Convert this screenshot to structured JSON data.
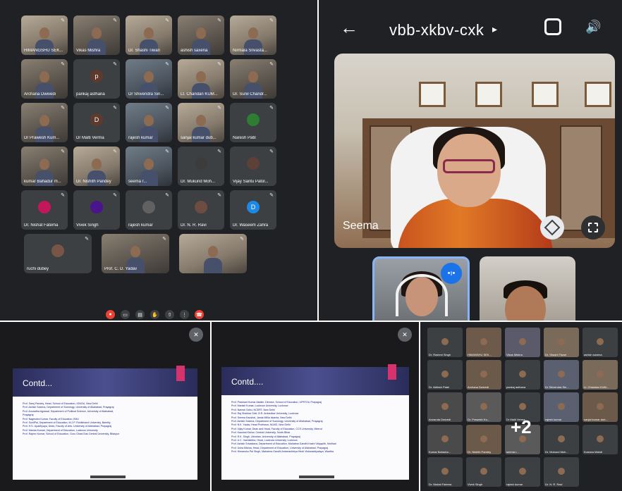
{
  "panel_grid": {
    "tiles": [
      {
        "name": "HIMANGSHU SEK...",
        "type": "video2"
      },
      {
        "name": "Vikas Mishra",
        "type": "video"
      },
      {
        "name": "Dr. Shashi Tiwari",
        "type": "video2"
      },
      {
        "name": "ashish saxena",
        "type": "video"
      },
      {
        "name": "Nirmala Srivasta...",
        "type": "video2"
      },
      {
        "name": "Archana Dwivedi",
        "type": "video"
      },
      {
        "name": "pankaj asthana",
        "type": "avatar",
        "initial": "p",
        "color": "#5e3a2c"
      },
      {
        "name": "Dr Shivendra Sin...",
        "type": "video3"
      },
      {
        "name": "Lt. Chandan KUM...",
        "type": "video2"
      },
      {
        "name": "Dr. Sunil Chandr...",
        "type": "video"
      },
      {
        "name": "Dr Prawesh Kum...",
        "type": "video"
      },
      {
        "name": "Dr Malti Verma",
        "type": "avatar",
        "initial": "D",
        "color": "#5e3a2c"
      },
      {
        "name": "rajesh kumar",
        "type": "video3"
      },
      {
        "name": "sanjai kumar dub...",
        "type": "video2"
      },
      {
        "name": "Naresh Patil",
        "type": "avatar",
        "initial": "",
        "color": "#2e7d32"
      },
      {
        "name": "kumar Bahadur m...",
        "type": "video"
      },
      {
        "name": "Dr. Nishith Pandey",
        "type": "video2"
      },
      {
        "name": "seema r...",
        "type": "video3"
      },
      {
        "name": "Dr. Mukund Moh...",
        "type": "avatar",
        "initial": "",
        "color": "#3c3c3c"
      },
      {
        "name": "Vijay Santu Patol...",
        "type": "avatar",
        "initial": "",
        "color": "#5d4037"
      },
      {
        "name": "Dr. Nishat Fatema",
        "type": "avatar",
        "initial": "",
        "color": "#c2185b"
      },
      {
        "name": "Vivek Singh",
        "type": "avatar",
        "initial": "",
        "color": "#4a148c"
      },
      {
        "name": "rajesh kumar",
        "type": "avatar",
        "initial": "",
        "color": "#616161"
      },
      {
        "name": "Dr. N. R. Ravi",
        "type": "avatar",
        "initial": "",
        "color": "#6d4c41"
      },
      {
        "name": "Dr. Waseem Zahra",
        "type": "avatar",
        "initial": "D",
        "color": "#1e88e5"
      },
      {
        "name": "ruchi dubey",
        "type": "avatar",
        "initial": "",
        "color": "#795548"
      },
      {
        "name": "Prof. C. D. Yadav",
        "type": "video"
      },
      {
        "name": "",
        "type": "video2"
      }
    ]
  },
  "panel_meet": {
    "meeting_code": "vbb-xkbv-cxk",
    "back_glyph": "←",
    "caret_glyph": "▸",
    "speaker_glyph": "🔊",
    "speaker_name": "Seema",
    "talking_glyph": "•ı•"
  },
  "slides": [
    {
      "title": "Contd...",
      "lines": [
        "Prof. Saroj Pandey, Head, School of Education, IGNOU, New Delhi",
        "Prof. Ashish Saxena, Department of Sociology, University of Allahabad, Prayagraj",
        "Prof. Anuradha Agrawal, Department of Political Science, University of Allahabad,",
        "Prayagraj",
        "Prof. Nagendra Kumar, Faculty of Education, BHU",
        "Prof. SunilPal, Department of Education, M.J.P. Rohilkhand University, Bareilly",
        "Prof. H.S. Upadhyaya, Dean, Faculty of Arts, University of Allahabad, Prayagraj",
        "Prof. Mamta Kumari, Department of Education, Lucknow University",
        "Prof. Rajeev Kumar, School of Education, Guru Ghasi Das Central University, Bilaspur"
      ]
    },
    {
      "title": "Contd....",
      "lines": [
        "Prof. Prashant Kumar Astalin, Director, School of Education, UPRTOU Prayagraj",
        "Prof. Manish Kumar, Lucknow University, Lucknow",
        "Prof. Naresh Sahu, NCERT, New Delhi",
        "Prof. Raj Shekhar Dixit, B.R. Ambedkar University, Lucknow",
        "Prof. Seema Kaushal, Jamia Millia Islamia, New Delhi",
        "Prof. Ashish Saxena, Department of Sociology, University of Allahabad, Prayagraj",
        "Prof. N.K. Yadav, Head Professor, NLMG, New Delhi",
        "Prof. Vijay Kumar, Dean and Head, Faculty of Education, CCS University, Meerut",
        "Prof. Kaushal Kishor, Central University, South Bihar",
        "Prof. R.K. Singh, Librarian, University of Allahabad, Prayagraj",
        "Prof. U.C. Vashishtha, Head, Lucknow University, Lucknow",
        "Prof. Ashish Srivastava, Department of Education, Mahatma Gandhi Kashi Vidyapith, Motihari",
        "Prof. Usha Mishra, Head, Department of Education, University of Allahabad, Prayagraj",
        "Prof. Himanshu Pal Singh, Mahatma Gandhi Antarrashtriya Hindi Vishwavidyalaya, Wardha"
      ]
    }
  ],
  "panel_small": {
    "overflow_label": "+2",
    "tiles": [
      {
        "name": "Dr. Rashmi Singh",
        "color": "#3c4043"
      },
      {
        "name": "HIMANSHU SEK...",
        "color": "#6d5a4a"
      },
      {
        "name": "Vikas Mishra",
        "color": "#5a5a6a"
      },
      {
        "name": "Dr. Shashi Tiwari",
        "color": "#7a6a5a"
      },
      {
        "name": "ashish saxena",
        "color": "#3c4043"
      },
      {
        "name": "Dr. Akilesh Patel",
        "color": "#3c4043"
      },
      {
        "name": "Archana Dwivedi",
        "color": "#6b5a4a"
      },
      {
        "name": "pankaj asthana",
        "color": "#3c4043"
      },
      {
        "name": "Dr Shivendra Sin...",
        "color": "#5a6070"
      },
      {
        "name": "Lt. Chandan KUM...",
        "color": "#7a6a5a"
      },
      {
        "name": "Annanda Dwivedi",
        "color": "#4a4a4a"
      },
      {
        "name": "Dr. Prawesh Ku...",
        "color": "#5a5a5a"
      },
      {
        "name": "Dr Malti Verma",
        "color": "#3c4043"
      },
      {
        "name": "rajesh kumar",
        "color": "#5a6070"
      },
      {
        "name": "sanjai kumar dub...",
        "color": "#6b5a4a"
      },
      {
        "name": "Kumar Bahadur...",
        "color": "#4a4a4a"
      },
      {
        "name": "Dr. Nishith Pandey",
        "color": "#6b5a4a"
      },
      {
        "name": "seema r...",
        "color": "#5a5a5a"
      },
      {
        "name": "Dr. Mukund Moh...",
        "color": "#3c4043"
      },
      {
        "name": "Kumara Mahdi",
        "color": "#3c4043"
      },
      {
        "name": "Dr. Nishat Fatema",
        "color": "#3c4043"
      },
      {
        "name": "Vivek Singh",
        "color": "#3c4043"
      },
      {
        "name": "rajesh kumar",
        "color": "#3c4043"
      },
      {
        "name": "Dr. N. R. Ravi",
        "color": "#3c4043"
      }
    ]
  }
}
